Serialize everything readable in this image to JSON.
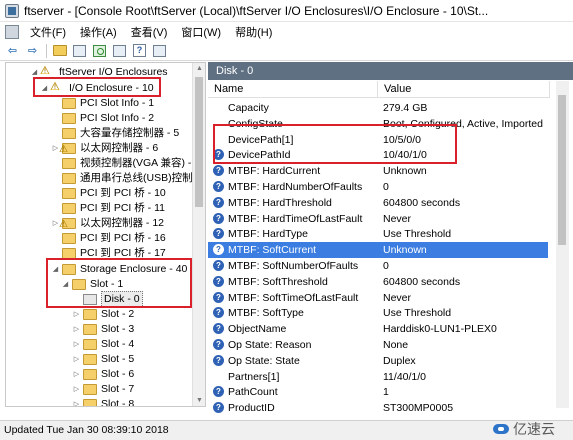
{
  "window": {
    "title": "ftserver - [Console Root\\ftServer (Local)\\ftServer I/O Enclosures\\I/O Enclosure - 10\\St..."
  },
  "menu": {
    "items": [
      "文件(F)",
      "操作(A)",
      "查看(V)",
      "窗口(W)",
      "帮助(H)"
    ]
  },
  "toolbar": {
    "help_label": "?"
  },
  "tree": {
    "items": [
      {
        "label": "ftServer I/O Enclosures",
        "icon": "warning-icon"
      },
      {
        "label": "I/O Enclosure - 10",
        "icon": "warning-icon"
      },
      {
        "label": "PCI Slot Info - 1",
        "icon": "folder-icon"
      },
      {
        "label": "PCI Slot Info - 2",
        "icon": "folder-icon"
      },
      {
        "label": "大容量存储控制器 - 5",
        "icon": "folder-icon"
      },
      {
        "label": "以太网控制器 - 6",
        "icon": "warning-folder-icon"
      },
      {
        "label": "视频控制器(VGA 兼容) - 7",
        "icon": "folder-icon"
      },
      {
        "label": "通用串行总线(USB)控制器",
        "icon": "folder-icon"
      },
      {
        "label": "PCI 到 PCI 桥 - 10",
        "icon": "folder-icon"
      },
      {
        "label": "PCI 到 PCI 桥 - 11",
        "icon": "folder-icon"
      },
      {
        "label": "以太网控制器 - 12",
        "icon": "warning-folder-icon"
      },
      {
        "label": "PCI 到 PCI 桥 - 16",
        "icon": "folder-icon"
      },
      {
        "label": "PCI 到 PCI 桥 - 17",
        "icon": "folder-icon"
      },
      {
        "label": "Storage Enclosure - 40",
        "icon": "folder-icon"
      },
      {
        "label": "Slot - 1",
        "icon": "folder-icon"
      },
      {
        "label": "Disk - 0",
        "icon": "disk-icon"
      },
      {
        "label": "Slot - 2",
        "icon": "folder-icon"
      },
      {
        "label": "Slot - 3",
        "icon": "folder-icon"
      },
      {
        "label": "Slot - 4",
        "icon": "folder-icon"
      },
      {
        "label": "Slot - 5",
        "icon": "folder-icon"
      },
      {
        "label": "Slot - 6",
        "icon": "folder-icon"
      },
      {
        "label": "Slot - 7",
        "icon": "folder-icon"
      },
      {
        "label": "Slot - 8",
        "icon": "folder-icon"
      }
    ]
  },
  "details": {
    "panel_title": "Disk - 0",
    "columns": {
      "name": "Name",
      "value": "Value"
    },
    "rows": [
      {
        "name": "Capacity",
        "value": "279.4 GB",
        "icon": ""
      },
      {
        "name": "ConfigState",
        "value": "Boot, Configured, Active, Imported",
        "icon": ""
      },
      {
        "name": "DevicePath[1]",
        "value": "10/5/0/0",
        "icon": ""
      },
      {
        "name": "DevicePathId",
        "value": "10/40/1/0",
        "icon": "help-icon"
      },
      {
        "name": "MTBF: HardCurrent",
        "value": "Unknown",
        "icon": "help-icon"
      },
      {
        "name": "MTBF: HardNumberOfFaults",
        "value": "0",
        "icon": "help-icon"
      },
      {
        "name": "MTBF: HardThreshold",
        "value": "604800 seconds",
        "icon": "help-icon"
      },
      {
        "name": "MTBF: HardTimeOfLastFault",
        "value": "Never",
        "icon": "help-icon"
      },
      {
        "name": "MTBF: HardType",
        "value": "Use Threshold",
        "icon": "help-icon"
      },
      {
        "name": "MTBF: SoftCurrent",
        "value": "Unknown",
        "icon": "help-icon"
      },
      {
        "name": "MTBF: SoftNumberOfFaults",
        "value": "0",
        "icon": "help-icon"
      },
      {
        "name": "MTBF: SoftThreshold",
        "value": "604800 seconds",
        "icon": "help-icon"
      },
      {
        "name": "MTBF: SoftTimeOfLastFault",
        "value": "Never",
        "icon": "help-icon"
      },
      {
        "name": "MTBF: SoftType",
        "value": "Use Threshold",
        "icon": "help-icon"
      },
      {
        "name": "ObjectName",
        "value": "Harddisk0-LUN1-PLEX0",
        "icon": "help-icon"
      },
      {
        "name": "Op State: Reason",
        "value": "None",
        "icon": "help-icon"
      },
      {
        "name": "Op State: State",
        "value": "Duplex",
        "icon": "help-icon"
      },
      {
        "name": "Partners[1]",
        "value": "11/40/1/0",
        "icon": ""
      },
      {
        "name": "PathCount",
        "value": "1",
        "icon": "help-icon"
      },
      {
        "name": "ProductID",
        "value": "ST300MP0005",
        "icon": "help-icon"
      }
    ]
  },
  "status": {
    "text": "Updated Tue Jan 30 08:39:10 2018"
  },
  "watermark": {
    "text": "亿速云"
  },
  "colors": {
    "annotation": "#d9202b",
    "selection": "#3b7de0",
    "panel_header": "#607083"
  }
}
